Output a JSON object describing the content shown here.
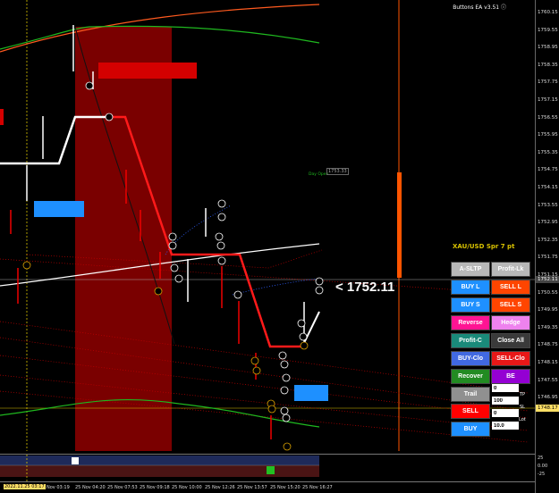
{
  "ea_title": "Buttons EA v3.51",
  "symbol_info": "XAU/USD Spr 7 pt",
  "current_price_label": "<  1752.11",
  "day_open": {
    "label": "Day Open",
    "value": "1753.33"
  },
  "price_axis": {
    "ticks": [
      "1760.15",
      "1759.55",
      "1758.95",
      "1758.35",
      "1757.75",
      "1757.15",
      "1756.55",
      "1755.95",
      "1755.35",
      "1754.75",
      "1754.15",
      "1753.55",
      "1752.95",
      "1752.35",
      "1751.75",
      "1751.15",
      "1750.55",
      "1749.95",
      "1749.35",
      "1748.75",
      "1748.15",
      "1747.55",
      "1746.95"
    ],
    "highlight_current": "1752.11",
    "highlight_level": "1748.17"
  },
  "indicator_axis": {
    "ticks": [
      "25",
      "0.00",
      "-25"
    ]
  },
  "time_axis": {
    "highlight_label": "2022.11.25 03:17",
    "labels": [
      "Nov 03:19",
      "25 Nov 04:20",
      "25 Nov 07:53",
      "25 Nov 09:18",
      "25 Nov 10:00",
      "25 Nov 12:26",
      "25 Nov 13:57",
      "25 Nov 15:20",
      "25 Nov 16:27"
    ]
  },
  "buttons": {
    "a_sltp": "A-SLTP",
    "profit_lk": "Profit-Lk",
    "buy_l": "BUY L",
    "sell_l": "SELL L",
    "buy_s": "BUY S",
    "sell_s": "SELL S",
    "reverse": "Reverse",
    "hedge": "Hedge",
    "profit_c": "Profit-C",
    "close_all": "Close All",
    "buy_clo": "BUY-Clo",
    "sell_clo": "SELL-Clo",
    "recover": "Recover",
    "be": "BE",
    "trail": "Trail",
    "sell": "SELL",
    "buy": "BUY"
  },
  "inputs": {
    "trail_value": "0",
    "tp_label": "TP",
    "tp_value": "100",
    "sl_label": "SL",
    "sl_value": "0",
    "lot_label": "Lot",
    "lot_value": "10.0"
  },
  "colors": {
    "a_sltp": "#b8b8b8",
    "profit_lk": "#b8b8b8",
    "buy": "#1e90ff",
    "sell_l": "#ff4500",
    "reverse": "#ff1493",
    "hedge": "#ee82ee",
    "profit_c": "#1a8a7a",
    "close_all": "#3a3a3a",
    "buy_clo": "#4169e1",
    "sell_clo": "#e81818",
    "recover": "#228b22",
    "be": "#9400d3",
    "trail": "#909090",
    "sell": "#ff0000",
    "highlight_level": "#ffe066"
  }
}
